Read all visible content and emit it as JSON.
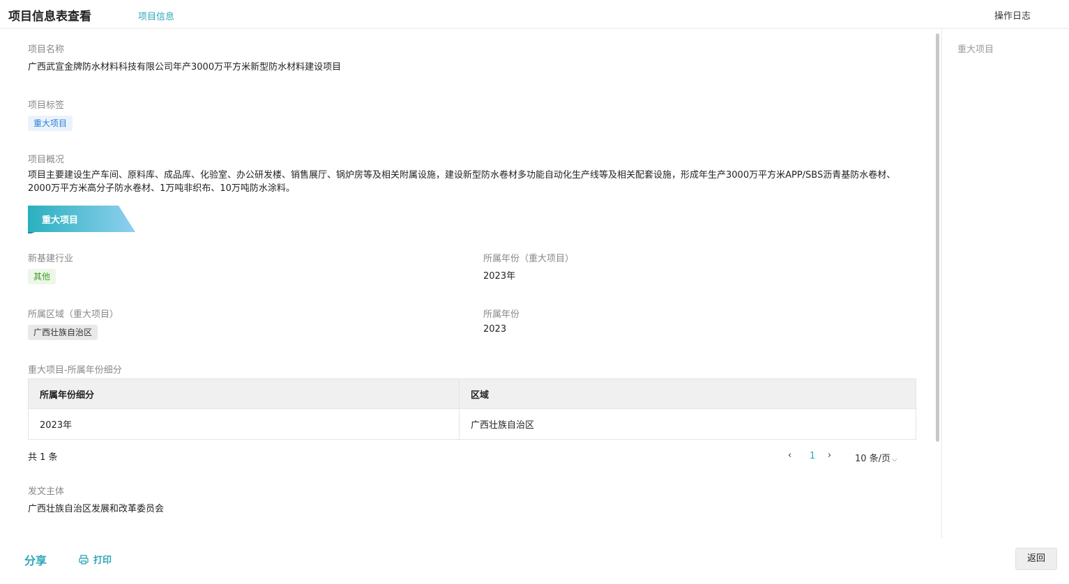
{
  "header": {
    "title": "项目信息表查看",
    "tab_info": "项目信息",
    "operation_log": "操作日志"
  },
  "sidebar": {
    "anchor_major": "重大项目"
  },
  "fields": {
    "project_name_label": "项目名称",
    "project_name_value": "广西武宣金牌防水材料科技有限公司年产3000万平方米新型防水材料建设项目",
    "project_tag_label": "项目标签",
    "project_tag_value": "重大项目",
    "overview_label": "项目概况",
    "overview_value": "项目主要建设生产车间、原料库、成品库、化验室、办公研发楼、销售展厅、锅炉房等及相关附属设施，建设新型防水卷材多功能自动化生产线等及相关配套设施，形成年生产3000万平方米APP/SBS沥青基防水卷材、2000万平方米高分子防水卷材、1万吨非织布、10万吨防水涂料。"
  },
  "section": {
    "title": "重大项目",
    "new_infra_label": "新基建行业",
    "new_infra_value": "其他",
    "year_major_label": "所属年份（重大项目）",
    "year_major_value": "2023年",
    "region_major_label": "所属区域（重大项目）",
    "region_major_value": "广西壮族自治区",
    "year_label": "所属年份",
    "year_value": "2023",
    "breakdown_label": "重大项目-所属年份细分",
    "table": {
      "headers": [
        "所属年份细分",
        "区域"
      ],
      "rows": [
        [
          "2023年",
          "广西壮族自治区"
        ]
      ]
    },
    "pager": {
      "total": "共 1 条",
      "prev": "‹",
      "current_page": "1",
      "next": "›",
      "page_size": "10 条/页"
    }
  },
  "issuer": {
    "label": "发文主体",
    "value": "广西壮族自治区发展和改革委员会"
  },
  "footer": {
    "share": "分享",
    "print": "打印",
    "back": "返回"
  },
  "colors": {
    "accent": "#2aa7b8",
    "banner_start": "#2ab0be",
    "banner_end": "#8fd0ef"
  }
}
